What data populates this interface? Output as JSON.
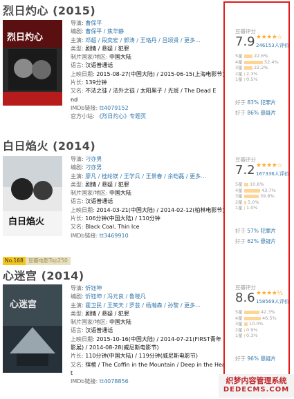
{
  "films": [
    {
      "title": "烈日灼心 (2015)",
      "fields": [
        {
          "label": "导演:",
          "value": "曹保平"
        },
        {
          "label": "编剧:",
          "value": "曹保平 / 焦华静"
        },
        {
          "label": "主演:",
          "value": "邓超 / 段奕宏 / 郭涛 / 王珞丹 / 吕颂贤 / 更多..."
        },
        {
          "label": "类型:",
          "value": "剧情 / 悬疑 / 犯罪"
        },
        {
          "label": "制片国家/地区:",
          "value": "中国大陆"
        },
        {
          "label": "语言:",
          "value": "汉语普通话"
        },
        {
          "label": "上映日期:",
          "value": "2015-08-27(中国大陆) / 2015-06-15(上海电影节)"
        },
        {
          "label": "片长:",
          "value": "139分钟"
        },
        {
          "label": "又名:",
          "value": "不法之徒 / 法外之徒 / 太阳黑子 / 光斑 / The Dead E"
        },
        {
          "label": "",
          "value": "nd"
        },
        {
          "label": "IMDb链接:",
          "value": "tt4079152"
        },
        {
          "label": "官方小站:",
          "value": "《烈日灼心》专题页"
        }
      ],
      "poster_text": "烈日灼心",
      "rating": {
        "label": "豆瓣评分",
        "score": "7.9",
        "stars": "★★★★☆",
        "votes": "246153人评价",
        "dist": [
          {
            "star": "5星",
            "pct": "22.6%",
            "v": 22.6
          },
          {
            "star": "4星",
            "pct": "52.4%",
            "v": 52.4
          },
          {
            "star": "3星",
            "pct": "22.2%",
            "v": 22.2
          },
          {
            "star": "2星",
            "pct": "2.3%",
            "v": 2.3
          },
          {
            "star": "1星",
            "pct": "0.5%",
            "v": 0.5
          }
        ],
        "better": [
          {
            "pre": "好于",
            "pct": "83%",
            "genre": "犯罪片"
          },
          {
            "pre": "好于",
            "pct": "86%",
            "genre": "悬疑片"
          }
        ]
      }
    },
    {
      "title": "白日焰火 (2014)",
      "fields": [
        {
          "label": "导演:",
          "value": "刁亦男"
        },
        {
          "label": "编剧:",
          "value": "刁亦男"
        },
        {
          "label": "主演:",
          "value": "廖凡 / 桂纶镁 / 王学兵 / 王景春 / 余皑磊 / 更多..."
        },
        {
          "label": "类型:",
          "value": "剧情 / 悬疑 / 犯罪"
        },
        {
          "label": "制片国家/地区:",
          "value": "中国大陆"
        },
        {
          "label": "语言:",
          "value": "汉语普通话"
        },
        {
          "label": "上映日期:",
          "value": "2014-03-21(中国大陆) / 2014-02-12(柏林电影节)"
        },
        {
          "label": "片长:",
          "value": "106分钟(中国大陆) / 110分钟"
        },
        {
          "label": "又名:",
          "value": "Black Coal, Thin Ice"
        },
        {
          "label": "IMDb链接:",
          "value": "tt3469910"
        }
      ],
      "poster_text": "白日焰火",
      "rating": {
        "label": "豆瓣评分",
        "score": "7.2",
        "stars": "★★★★☆",
        "votes": "167336人评价",
        "dist": [
          {
            "star": "5星",
            "pct": "10.6%",
            "v": 10.6
          },
          {
            "star": "4星",
            "pct": "43.7%",
            "v": 43.7
          },
          {
            "star": "3星",
            "pct": "39.8%",
            "v": 39.8
          },
          {
            "star": "2星",
            "pct": "5.0%",
            "v": 5.0
          },
          {
            "star": "1星",
            "pct": "1.0%",
            "v": 1.0
          }
        ],
        "better": [
          {
            "pre": "好于",
            "pct": "57%",
            "genre": "犯罪片"
          },
          {
            "pre": "好于",
            "pct": "62%",
            "genre": "悬疑片"
          }
        ]
      }
    },
    {
      "badge_no": "No.168",
      "badge_text": "豆瓣电影Top250",
      "title": "心迷宫 (2014)",
      "fields": [
        {
          "label": "导演:",
          "value": "忻钰坤"
        },
        {
          "label": "编剧:",
          "value": "忻钰坤 / 冯元良 / 鲁晓凡"
        },
        {
          "label": "主演:",
          "value": "霍卫民 / 王笑天 / 罗芸 / 杨瀚森 / 孙黎 / 更多..."
        },
        {
          "label": "类型:",
          "value": "剧情 / 悬疑 / 犯罪"
        },
        {
          "label": "制片国家/地区:",
          "value": "中国大陆"
        },
        {
          "label": "语言:",
          "value": "汉语普通话"
        },
        {
          "label": "上映日期:",
          "value": "2015-10-16(中国大陆) / 2014-07-21(FIRST青年"
        },
        {
          "label": "",
          "value": "影展) / 2014-08-28(威尼斯电影节)"
        },
        {
          "label": "片长:",
          "value": "110分钟(中国大陆) / 119分钟(威尼斯电影节)"
        },
        {
          "label": "又名:",
          "value": "殡棺 / The Coffin in the Mountain / Deep in the Hear"
        },
        {
          "label": "",
          "value": "t"
        },
        {
          "label": "IMDb链接:",
          "value": "tt4078856"
        }
      ],
      "poster_text": "心迷宫",
      "rating": {
        "label": "豆瓣评分",
        "score": "8.6",
        "stars": "★★★★½",
        "votes": "158569人评价",
        "dist": [
          {
            "star": "5星",
            "pct": "42.3%",
            "v": 42.3
          },
          {
            "star": "4星",
            "pct": "46.5%",
            "v": 46.5
          },
          {
            "star": "3星",
            "pct": "10.0%",
            "v": 10.0
          },
          {
            "star": "2星",
            "pct": "0.9%",
            "v": 0.9
          },
          {
            "star": "1星",
            "pct": "0.3%",
            "v": 0.3
          }
        ],
        "better": [
          {
            "pre": "好于",
            "pct": "96%",
            "genre": "悬疑片"
          }
        ]
      }
    }
  ],
  "watermark": {
    "line1": "织梦内容管理系统",
    "line2": "DEDECMS.COM"
  },
  "colors": {
    "link": "#3377aa",
    "star": "#ffac2d",
    "bar": "#ffd596",
    "frame": "#e21a1a"
  }
}
